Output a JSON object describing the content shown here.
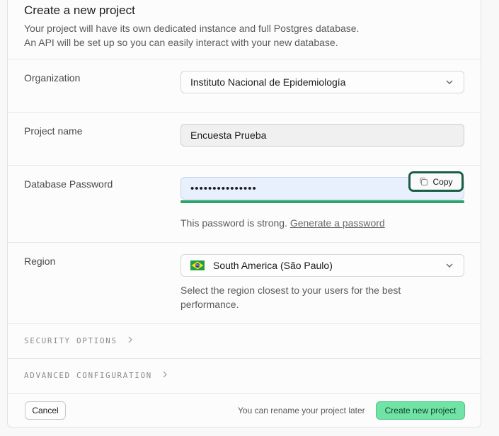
{
  "header": {
    "title": "Create a new project",
    "description_line1": "Your project will have its own dedicated instance and full Postgres database.",
    "description_line2": "An API will be set up so you can easily interact with your new database."
  },
  "organization": {
    "label": "Organization",
    "value": "Instituto Nacional de Epidemiología"
  },
  "project_name": {
    "label": "Project name",
    "value": "Encuesta Prueba"
  },
  "database_password": {
    "label": "Database Password",
    "value": "•••••••••••••••",
    "copy_label": "Copy",
    "strength_fraction": 1.0,
    "strength_text": "This password is strong.",
    "generate_link": "Generate a password"
  },
  "region": {
    "label": "Region",
    "value": "South America (São Paulo)",
    "flag_icon": "brazil-flag-icon",
    "helper_line1": "Select the region closest to your users for the best",
    "helper_line2": "performance."
  },
  "sections": {
    "security": "SECURITY OPTIONS",
    "advanced": "ADVANCED CONFIGURATION"
  },
  "footer": {
    "cancel_label": "Cancel",
    "note": "You can rename your project later",
    "create_label": "Create new project"
  },
  "colors": {
    "accent": "#3ecf8e",
    "copy_border": "#1b5e44",
    "password_bg": "#e8f0fe"
  }
}
